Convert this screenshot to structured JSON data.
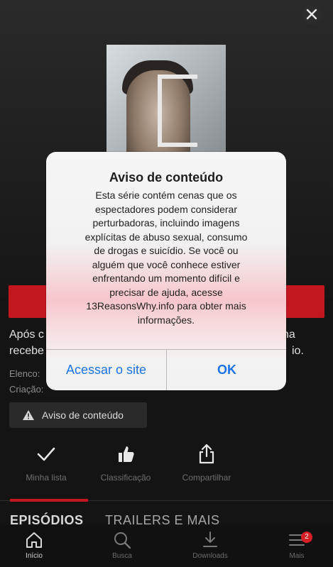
{
  "close_label": "✕",
  "poster": {
    "logo_text": ""
  },
  "synopsis": {
    "line1_left": "Após c",
    "line1_right": "na",
    "line2_left": "recebe",
    "line2_right": "io."
  },
  "meta": {
    "cast_prefix": "Elenco:",
    "creator_prefix": "Criação:"
  },
  "warning_chip": {
    "label": "Aviso de conteúdo",
    "icon": "warning-triangle-icon"
  },
  "actions": [
    {
      "label": "Minha lista",
      "icon": "check-icon"
    },
    {
      "label": "Classificação",
      "icon": "thumbs-up-icon"
    },
    {
      "label": "Compartilhar",
      "icon": "share-icon"
    }
  ],
  "tabs": [
    {
      "label": "EPISÓDIOS",
      "active": true
    },
    {
      "label": "TRAILERS E MAIS",
      "active": false
    }
  ],
  "bottom_nav": [
    {
      "label": "Início",
      "icon": "home-icon",
      "active": true
    },
    {
      "label": "Busca",
      "icon": "search-icon",
      "active": false
    },
    {
      "label": "Downloads",
      "icon": "download-icon",
      "active": false
    },
    {
      "label": "Mais",
      "icon": "menu-icon",
      "active": false,
      "badge": "2"
    }
  ],
  "dialog": {
    "title": "Aviso de conteúdo",
    "message_lines": [
      "Esta série contém cenas que os",
      "espectadores podem considerar",
      "perturbadoras, incluindo imagens",
      "explícitas de abuso sexual, consumo",
      "de drogas e suicídio. Se você ou",
      "alguém que você conhece estiver",
      "enfrentando um momento difícil e",
      "precisar de ajuda, acesse",
      "13ReasonsWhy.info para obter mais",
      "informações."
    ],
    "secondary_button": "Acessar o site",
    "primary_button": "OK"
  },
  "colors": {
    "accent_red": "#c4161f",
    "ios_blue": "#1a73e8",
    "background": "#141414"
  }
}
